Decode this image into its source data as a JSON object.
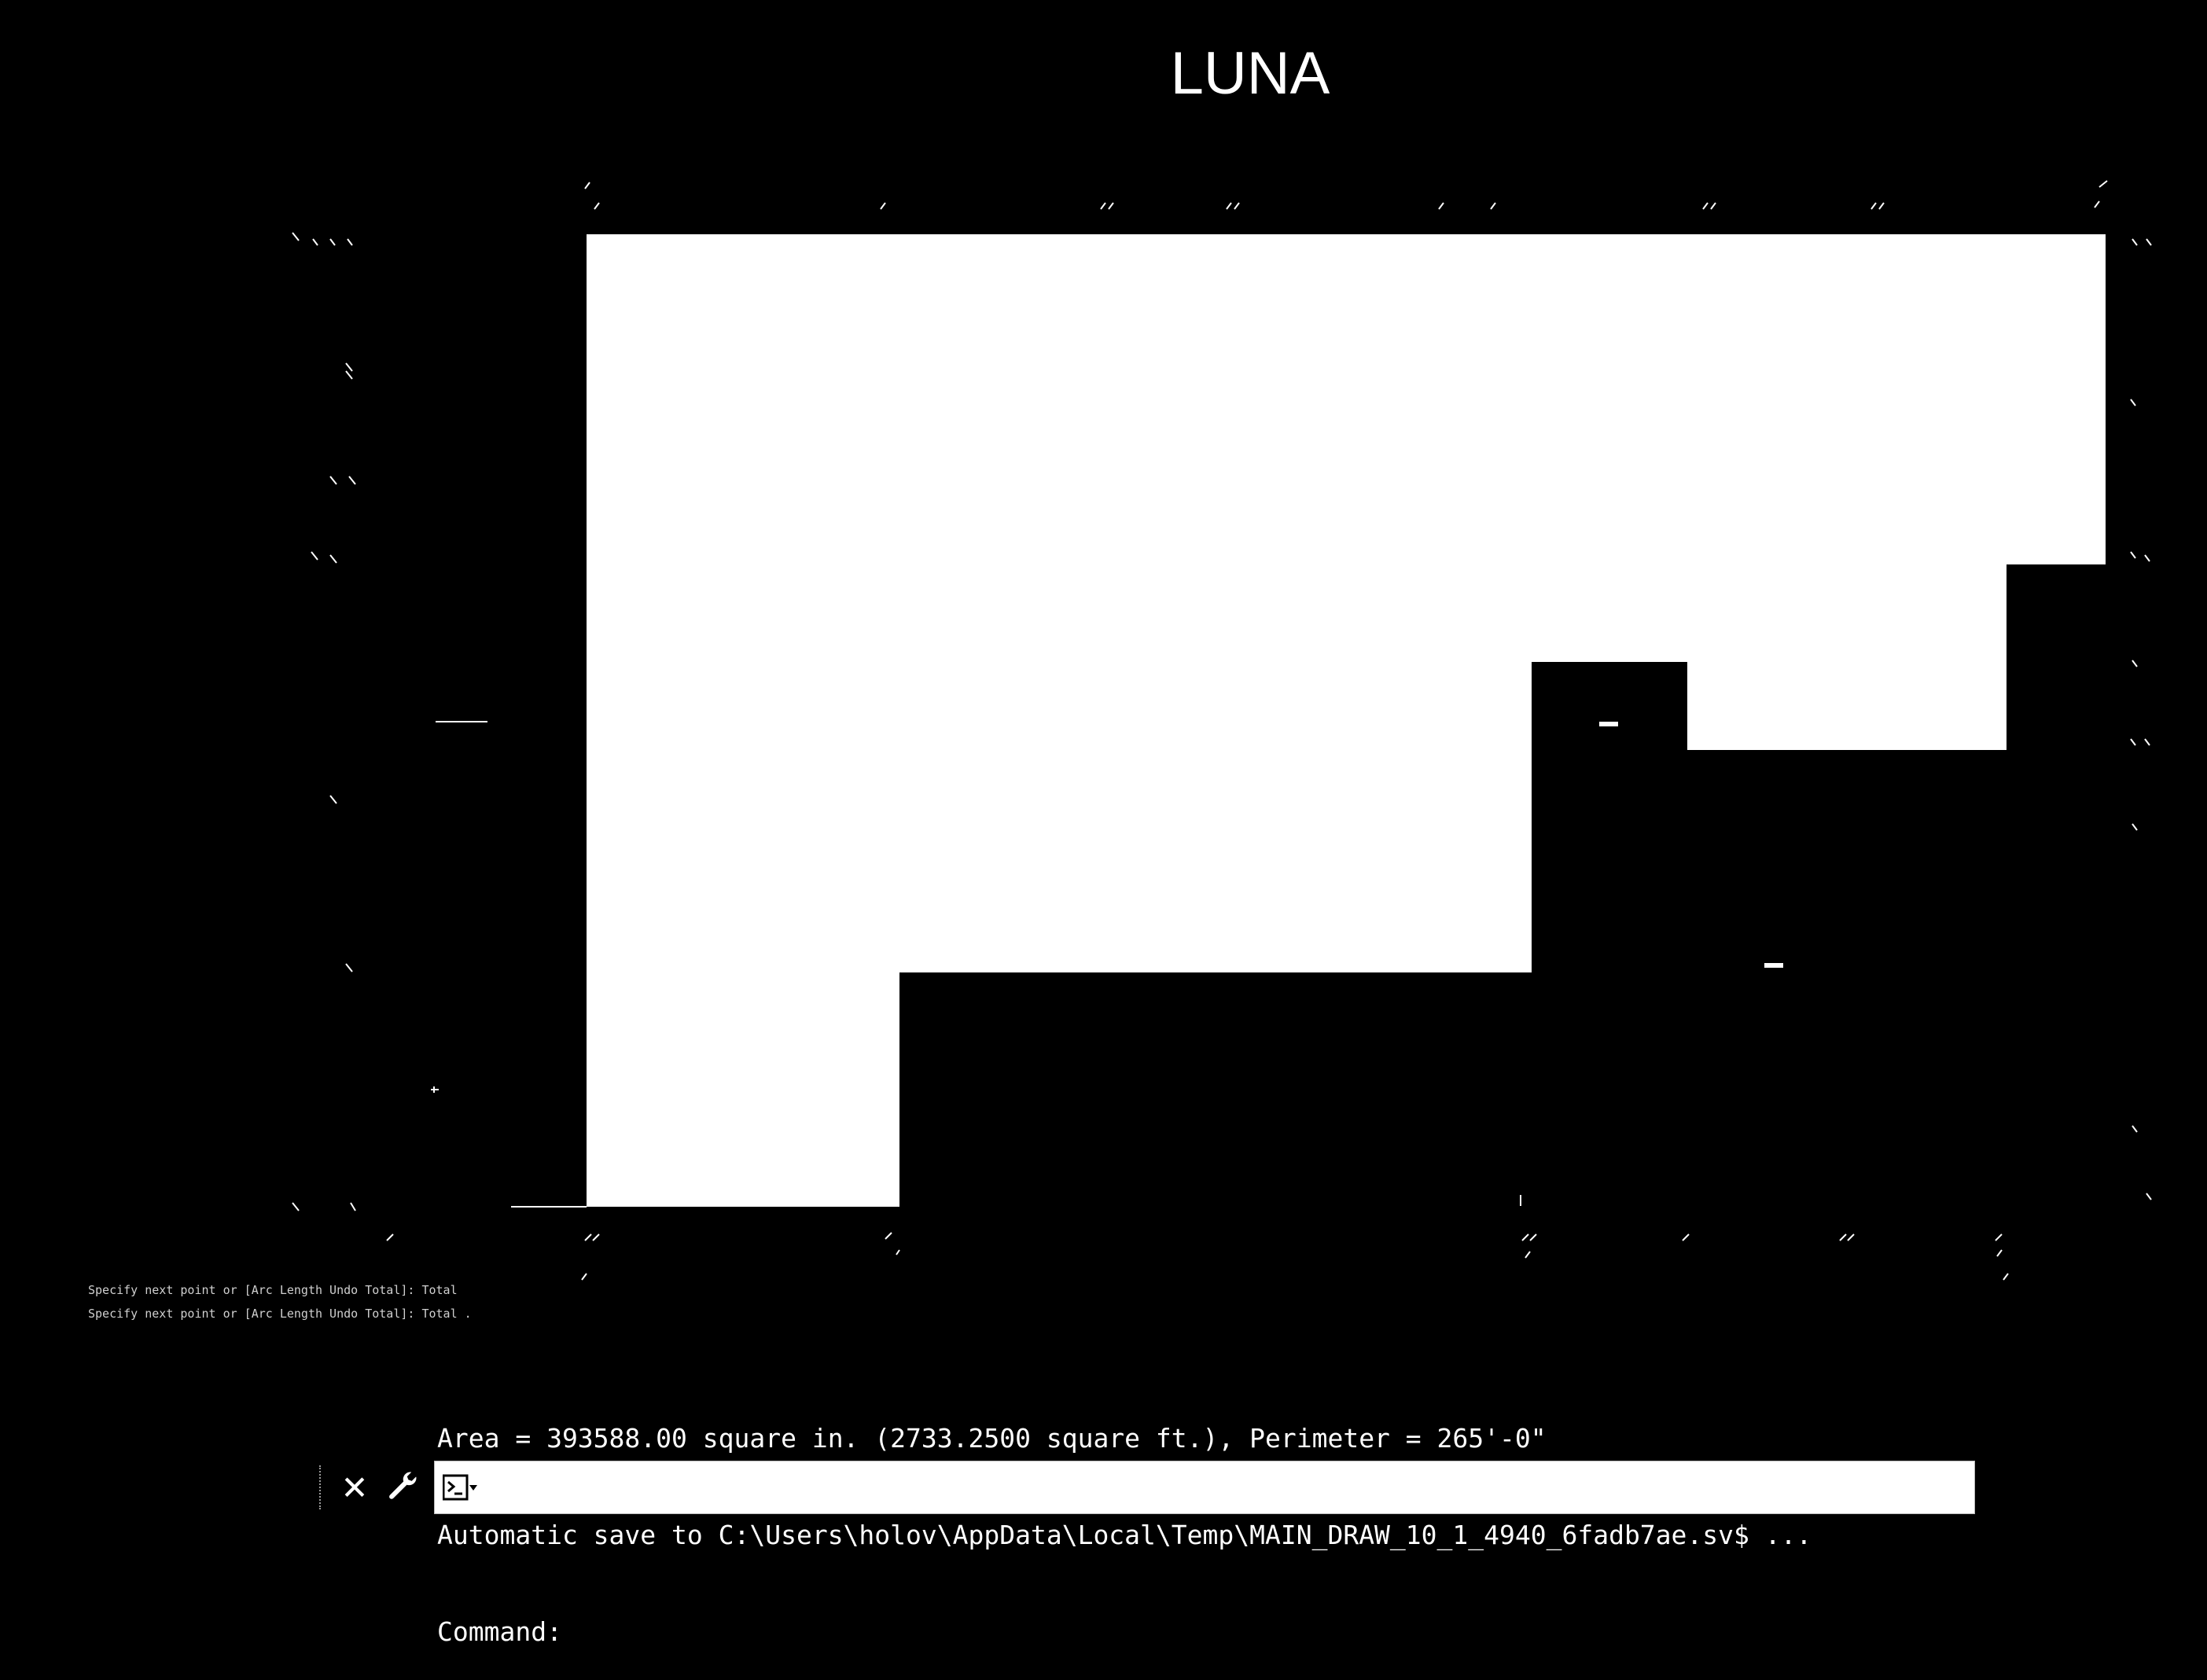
{
  "drawing": {
    "title": "LUNA"
  },
  "command_history": {
    "faded_lines": [
      "Specify next point or [Arc Length Undo Total]: Total",
      "Specify next point or [Arc Length Undo Total]: Total ."
    ],
    "lines": [
      "Area = 393588.00 square in. (2733.2500 square ft.), Perimeter = 265'-0\"",
      "Automatic save to C:\\Users\\holov\\AppData\\Local\\Temp\\MAIN_DRAW_10_1_4940_6fadb7ae.sv$ ...",
      "Command:"
    ]
  },
  "command_line": {
    "close_icon": "close-icon",
    "settings_icon": "wrench-icon",
    "prompt_icon": "command-prompt-icon",
    "input_value": "",
    "input_placeholder": ""
  },
  "colors": {
    "background": "#000000",
    "fill": "#ffffff"
  }
}
